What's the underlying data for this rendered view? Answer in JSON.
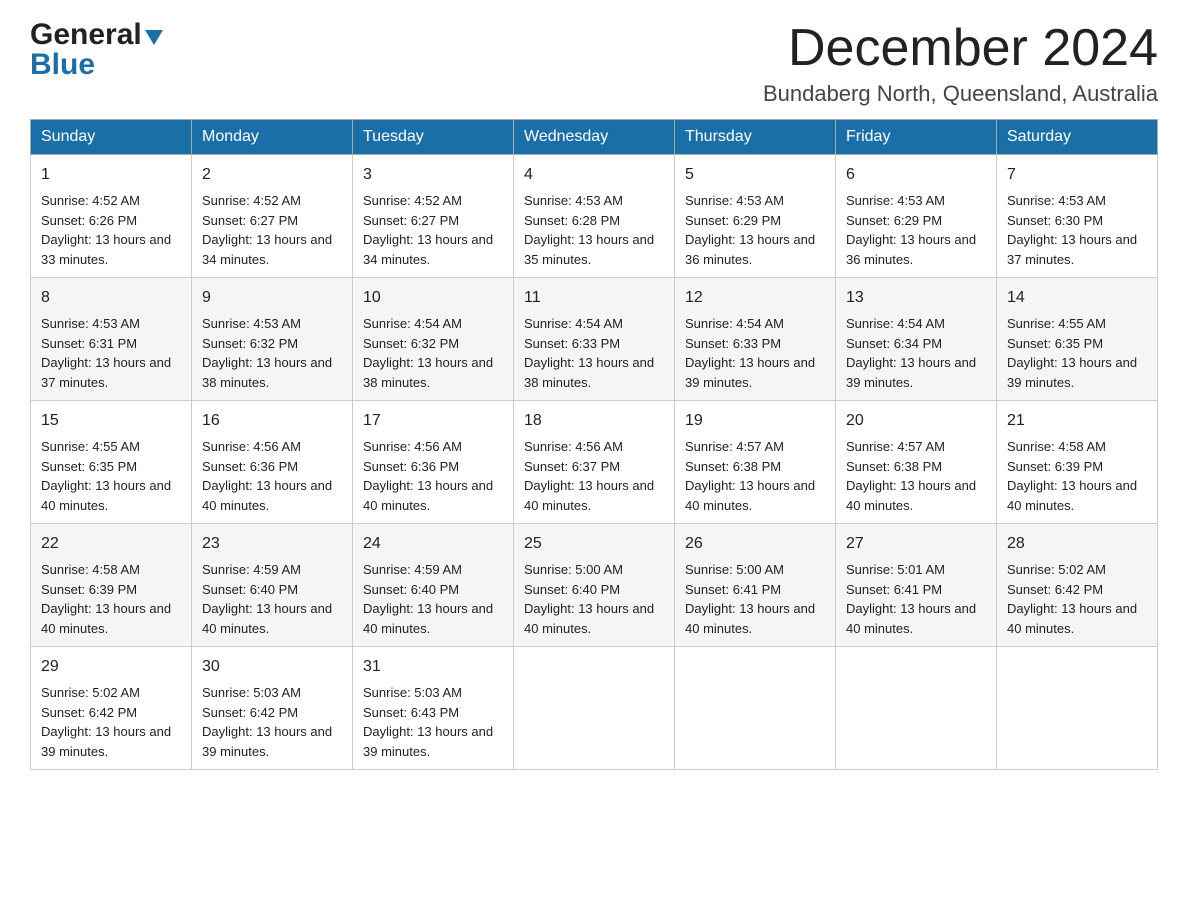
{
  "logo": {
    "general": "General",
    "blue": "Blue"
  },
  "title": "December 2024",
  "location": "Bundaberg North, Queensland, Australia",
  "headers": [
    "Sunday",
    "Monday",
    "Tuesday",
    "Wednesday",
    "Thursday",
    "Friday",
    "Saturday"
  ],
  "weeks": [
    [
      {
        "day": "1",
        "sunrise": "4:52 AM",
        "sunset": "6:26 PM",
        "daylight": "13 hours and 33 minutes."
      },
      {
        "day": "2",
        "sunrise": "4:52 AM",
        "sunset": "6:27 PM",
        "daylight": "13 hours and 34 minutes."
      },
      {
        "day": "3",
        "sunrise": "4:52 AM",
        "sunset": "6:27 PM",
        "daylight": "13 hours and 34 minutes."
      },
      {
        "day": "4",
        "sunrise": "4:53 AM",
        "sunset": "6:28 PM",
        "daylight": "13 hours and 35 minutes."
      },
      {
        "day": "5",
        "sunrise": "4:53 AM",
        "sunset": "6:29 PM",
        "daylight": "13 hours and 36 minutes."
      },
      {
        "day": "6",
        "sunrise": "4:53 AM",
        "sunset": "6:29 PM",
        "daylight": "13 hours and 36 minutes."
      },
      {
        "day": "7",
        "sunrise": "4:53 AM",
        "sunset": "6:30 PM",
        "daylight": "13 hours and 37 minutes."
      }
    ],
    [
      {
        "day": "8",
        "sunrise": "4:53 AM",
        "sunset": "6:31 PM",
        "daylight": "13 hours and 37 minutes."
      },
      {
        "day": "9",
        "sunrise": "4:53 AM",
        "sunset": "6:32 PM",
        "daylight": "13 hours and 38 minutes."
      },
      {
        "day": "10",
        "sunrise": "4:54 AM",
        "sunset": "6:32 PM",
        "daylight": "13 hours and 38 minutes."
      },
      {
        "day": "11",
        "sunrise": "4:54 AM",
        "sunset": "6:33 PM",
        "daylight": "13 hours and 38 minutes."
      },
      {
        "day": "12",
        "sunrise": "4:54 AM",
        "sunset": "6:33 PM",
        "daylight": "13 hours and 39 minutes."
      },
      {
        "day": "13",
        "sunrise": "4:54 AM",
        "sunset": "6:34 PM",
        "daylight": "13 hours and 39 minutes."
      },
      {
        "day": "14",
        "sunrise": "4:55 AM",
        "sunset": "6:35 PM",
        "daylight": "13 hours and 39 minutes."
      }
    ],
    [
      {
        "day": "15",
        "sunrise": "4:55 AM",
        "sunset": "6:35 PM",
        "daylight": "13 hours and 40 minutes."
      },
      {
        "day": "16",
        "sunrise": "4:56 AM",
        "sunset": "6:36 PM",
        "daylight": "13 hours and 40 minutes."
      },
      {
        "day": "17",
        "sunrise": "4:56 AM",
        "sunset": "6:36 PM",
        "daylight": "13 hours and 40 minutes."
      },
      {
        "day": "18",
        "sunrise": "4:56 AM",
        "sunset": "6:37 PM",
        "daylight": "13 hours and 40 minutes."
      },
      {
        "day": "19",
        "sunrise": "4:57 AM",
        "sunset": "6:38 PM",
        "daylight": "13 hours and 40 minutes."
      },
      {
        "day": "20",
        "sunrise": "4:57 AM",
        "sunset": "6:38 PM",
        "daylight": "13 hours and 40 minutes."
      },
      {
        "day": "21",
        "sunrise": "4:58 AM",
        "sunset": "6:39 PM",
        "daylight": "13 hours and 40 minutes."
      }
    ],
    [
      {
        "day": "22",
        "sunrise": "4:58 AM",
        "sunset": "6:39 PM",
        "daylight": "13 hours and 40 minutes."
      },
      {
        "day": "23",
        "sunrise": "4:59 AM",
        "sunset": "6:40 PM",
        "daylight": "13 hours and 40 minutes."
      },
      {
        "day": "24",
        "sunrise": "4:59 AM",
        "sunset": "6:40 PM",
        "daylight": "13 hours and 40 minutes."
      },
      {
        "day": "25",
        "sunrise": "5:00 AM",
        "sunset": "6:40 PM",
        "daylight": "13 hours and 40 minutes."
      },
      {
        "day": "26",
        "sunrise": "5:00 AM",
        "sunset": "6:41 PM",
        "daylight": "13 hours and 40 minutes."
      },
      {
        "day": "27",
        "sunrise": "5:01 AM",
        "sunset": "6:41 PM",
        "daylight": "13 hours and 40 minutes."
      },
      {
        "day": "28",
        "sunrise": "5:02 AM",
        "sunset": "6:42 PM",
        "daylight": "13 hours and 40 minutes."
      }
    ],
    [
      {
        "day": "29",
        "sunrise": "5:02 AM",
        "sunset": "6:42 PM",
        "daylight": "13 hours and 39 minutes."
      },
      {
        "day": "30",
        "sunrise": "5:03 AM",
        "sunset": "6:42 PM",
        "daylight": "13 hours and 39 minutes."
      },
      {
        "day": "31",
        "sunrise": "5:03 AM",
        "sunset": "6:43 PM",
        "daylight": "13 hours and 39 minutes."
      },
      null,
      null,
      null,
      null
    ]
  ]
}
